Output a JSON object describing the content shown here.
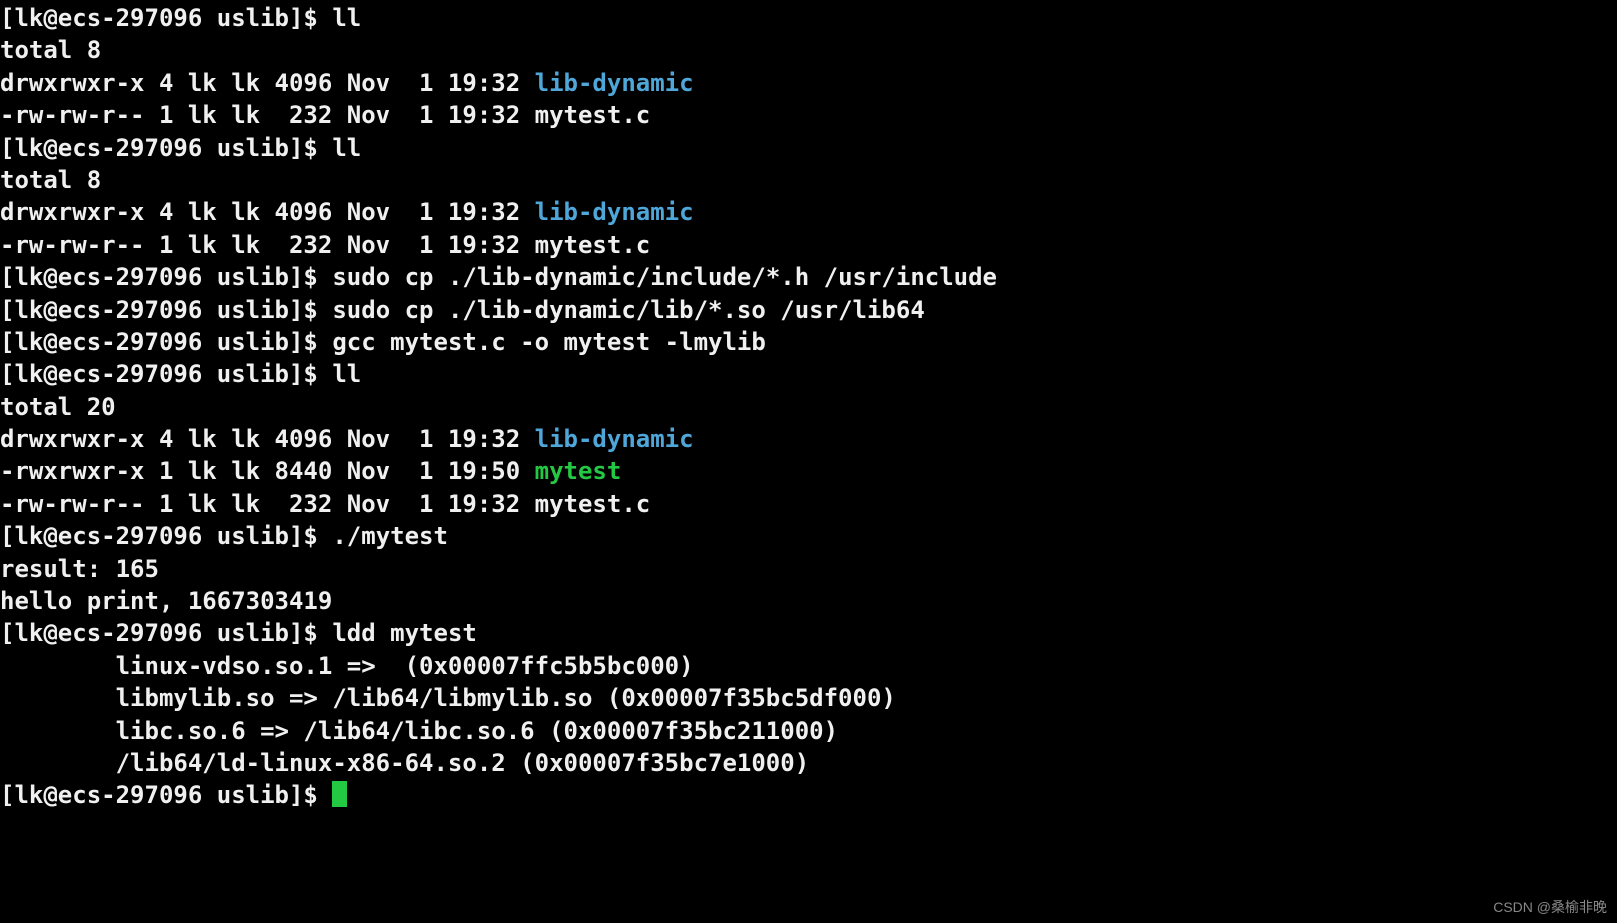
{
  "prompt": "[lk@ecs-297096 uslib]$ ",
  "watermark": "CSDN @桑榆非晚",
  "segments": [
    {
      "t": "prompt"
    },
    {
      "t": "txt",
      "v": "ll"
    },
    {
      "t": "nl"
    },
    {
      "t": "txt",
      "v": "total 8"
    },
    {
      "t": "nl"
    },
    {
      "t": "txt",
      "v": "drwxrwxr-x 4 lk lk 4096 Nov  1 19:32 "
    },
    {
      "t": "dir",
      "v": "lib-dynamic"
    },
    {
      "t": "nl"
    },
    {
      "t": "txt",
      "v": "-rw-rw-r-- 1 lk lk  232 Nov  1 19:32 mytest.c"
    },
    {
      "t": "nl"
    },
    {
      "t": "prompt"
    },
    {
      "t": "txt",
      "v": "ll"
    },
    {
      "t": "nl"
    },
    {
      "t": "txt",
      "v": "total 8"
    },
    {
      "t": "nl"
    },
    {
      "t": "txt",
      "v": "drwxrwxr-x 4 lk lk 4096 Nov  1 19:32 "
    },
    {
      "t": "dir",
      "v": "lib-dynamic"
    },
    {
      "t": "nl"
    },
    {
      "t": "txt",
      "v": "-rw-rw-r-- 1 lk lk  232 Nov  1 19:32 mytest.c"
    },
    {
      "t": "nl"
    },
    {
      "t": "prompt"
    },
    {
      "t": "txt",
      "v": "sudo cp ./lib-dynamic/include/*.h /usr/include"
    },
    {
      "t": "nl"
    },
    {
      "t": "prompt"
    },
    {
      "t": "txt",
      "v": "sudo cp ./lib-dynamic/lib/*.so /usr/lib64"
    },
    {
      "t": "nl"
    },
    {
      "t": "prompt"
    },
    {
      "t": "txt",
      "v": "gcc mytest.c -o mytest -lmylib"
    },
    {
      "t": "nl"
    },
    {
      "t": "prompt"
    },
    {
      "t": "txt",
      "v": "ll"
    },
    {
      "t": "nl"
    },
    {
      "t": "txt",
      "v": "total 20"
    },
    {
      "t": "nl"
    },
    {
      "t": "txt",
      "v": "drwxrwxr-x 4 lk lk 4096 Nov  1 19:32 "
    },
    {
      "t": "dir",
      "v": "lib-dynamic"
    },
    {
      "t": "nl"
    },
    {
      "t": "txt",
      "v": "-rwxrwxr-x 1 lk lk 8440 Nov  1 19:50 "
    },
    {
      "t": "exe",
      "v": "mytest"
    },
    {
      "t": "nl"
    },
    {
      "t": "txt",
      "v": "-rw-rw-r-- 1 lk lk  232 Nov  1 19:32 mytest.c"
    },
    {
      "t": "nl"
    },
    {
      "t": "prompt"
    },
    {
      "t": "txt",
      "v": "./mytest"
    },
    {
      "t": "nl"
    },
    {
      "t": "txt",
      "v": "result: 165"
    },
    {
      "t": "nl"
    },
    {
      "t": "txt",
      "v": "hello print, 1667303419"
    },
    {
      "t": "nl"
    },
    {
      "t": "prompt"
    },
    {
      "t": "txt",
      "v": "ldd mytest"
    },
    {
      "t": "nl"
    },
    {
      "t": "txt",
      "v": "        linux-vdso.so.1 =>  (0x00007ffc5b5bc000)"
    },
    {
      "t": "nl"
    },
    {
      "t": "txt",
      "v": "        libmylib.so => /lib64/libmylib.so (0x00007f35bc5df000)"
    },
    {
      "t": "nl"
    },
    {
      "t": "txt",
      "v": "        libc.so.6 => /lib64/libc.so.6 (0x00007f35bc211000)"
    },
    {
      "t": "nl"
    },
    {
      "t": "txt",
      "v": "        /lib64/ld-linux-x86-64.so.2 (0x00007f35bc7e1000)"
    },
    {
      "t": "nl"
    },
    {
      "t": "prompt"
    },
    {
      "t": "cursor"
    }
  ]
}
